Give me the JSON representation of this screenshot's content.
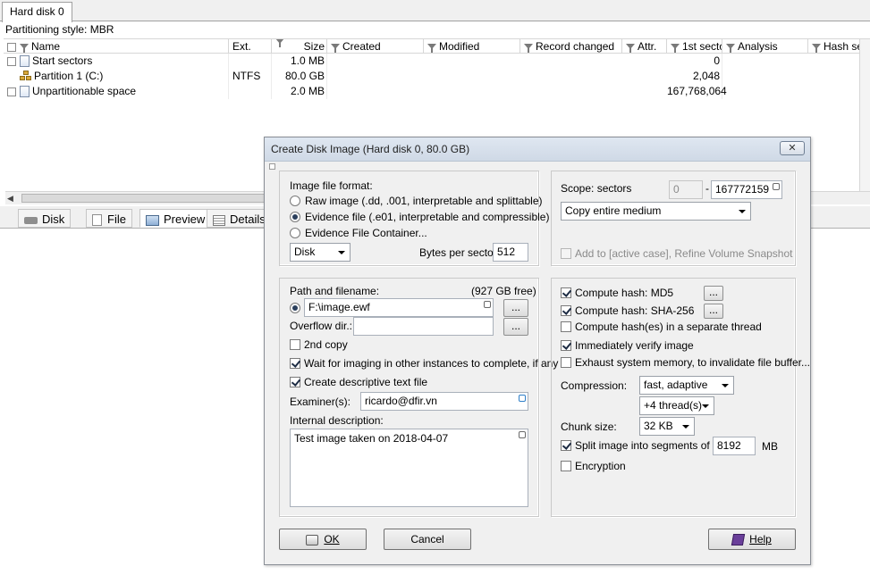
{
  "window": {
    "tab_label": "Hard disk 0",
    "partitioning_style": "Partitioning style: MBR"
  },
  "grid": {
    "columns": [
      "Name",
      "Ext.",
      "Size",
      "Created",
      "Modified",
      "Record changed",
      "Attr.",
      "1st secto",
      "Analysis",
      "Hash set"
    ],
    "rows": [
      {
        "name": "Start sectors",
        "ext": "",
        "size": "1.0 MB",
        "first_sector": "0",
        "icon": "file-icon"
      },
      {
        "name": "Partition 1 (C:)",
        "ext": "NTFS",
        "size": "80.0 GB",
        "first_sector": "2,048",
        "icon": "partition-icon"
      },
      {
        "name": "Unpartitionable space",
        "ext": "",
        "size": "2.0 MB",
        "first_sector": "167,768,064",
        "icon": "file-icon"
      }
    ]
  },
  "lower_tabs": [
    "Disk",
    "File",
    "Preview",
    "Details"
  ],
  "dialog": {
    "title": "Create Disk Image (Hard disk 0, 80.0 GB)",
    "close_glyph": "✕",
    "format": {
      "heading": "Image file format:",
      "options": [
        {
          "label": "Raw image (.dd, .001, interpretable and splittable)",
          "selected": false
        },
        {
          "label": "Evidence file (.e01, interpretable and compressible)",
          "selected": true
        },
        {
          "label": "Evidence File Container...",
          "selected": false
        }
      ],
      "source_select": "Disk",
      "bytes_per_sector_label": "Bytes per sector:",
      "bytes_per_sector": "512"
    },
    "scope": {
      "label": "Scope: sectors",
      "from": "0",
      "dash": "-",
      "to": "167772159",
      "copy_select": "Copy entire medium",
      "add_to_case_label": "Add to [active case], Refine Volume Snapshot",
      "add_to_case_checked": false
    },
    "path": {
      "label": "Path and filename:",
      "free_space": "(927 GB free)",
      "value": "F:\\image.ewf",
      "browse_label": "...",
      "overflow_label": "Overflow dir.:",
      "overflow_value": "",
      "second_copy_label": "2nd copy",
      "second_copy_checked": false,
      "wait_label": "Wait for imaging in other instances to complete, if any",
      "wait_checked": true,
      "descriptive_label": "Create descriptive text file",
      "descriptive_checked": true,
      "examiner_label": "Examiner(s):",
      "examiner_value": "ricardo@dfir.vn",
      "internal_desc_label": "Internal description:",
      "internal_desc_value": "Test image taken on 2018-04-07"
    },
    "hash": {
      "md5_label": "Compute hash: MD5",
      "md5_checked": true,
      "sha_label": "Compute hash: SHA-256",
      "sha_checked": true,
      "separate_thread_label": "Compute hash(es) in a separate thread",
      "separate_thread_checked": false,
      "verify_label": "Immediately verify image",
      "verify_checked": true,
      "exhaust_label": "Exhaust system memory, to invalidate file buffer...",
      "exhaust_checked": false,
      "options_glyph": "..."
    },
    "compression": {
      "label": "Compression:",
      "value": "fast, adaptive",
      "threads": "+4 thread(s)",
      "chunk_label": "Chunk size:",
      "chunk_value": "32 KB",
      "split_label": "Split image into segments of",
      "split_checked": true,
      "split_value": "8192",
      "split_unit": "MB",
      "encryption_label": "Encryption",
      "encryption_checked": false
    },
    "buttons": {
      "ok": "OK",
      "cancel": "Cancel",
      "help": "Help"
    }
  }
}
